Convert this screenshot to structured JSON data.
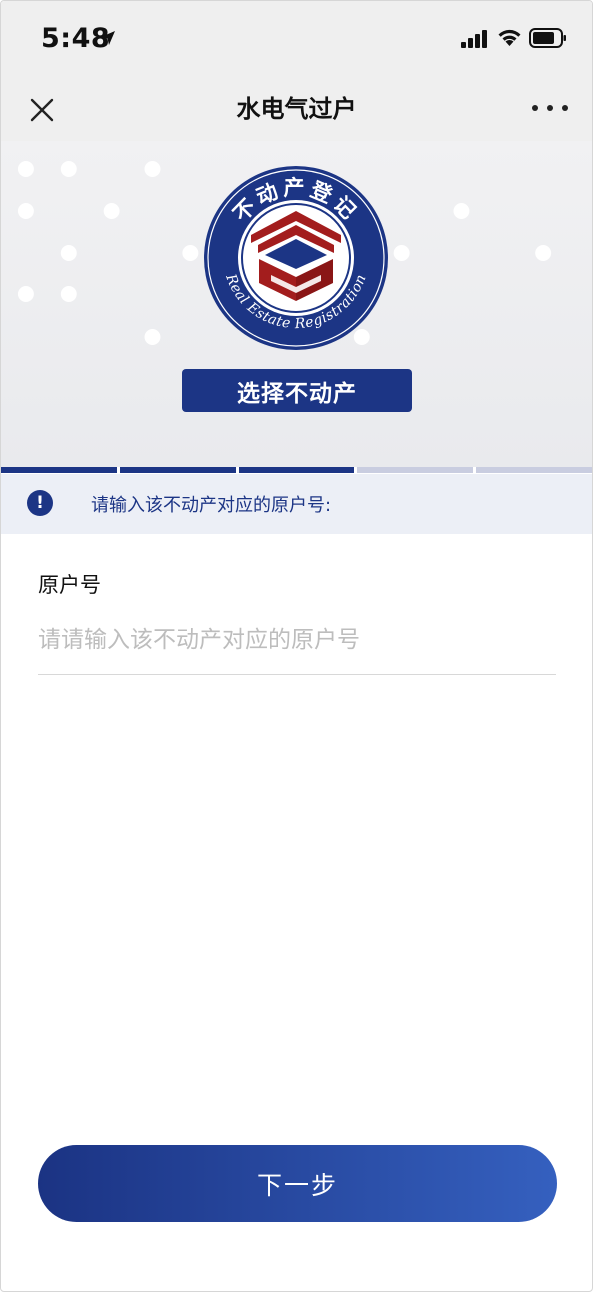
{
  "status_bar": {
    "time": "5:48",
    "icons": [
      "location-arrow-icon",
      "cellular-signal-icon",
      "wifi-icon",
      "battery-icon"
    ]
  },
  "nav": {
    "title": "水电气过户",
    "close_icon": "close-icon",
    "more_icon": "more-icon"
  },
  "hero": {
    "emblem": {
      "top_text": "不动产登记",
      "bottom_text": "Real Estate Registration",
      "ring_color": "#1c3585",
      "house_color": "#a31d1d"
    },
    "select_button_label": "选择不动产"
  },
  "progress": {
    "segments": 5,
    "completed": 3
  },
  "notice": {
    "icon": "exclamation-icon",
    "text": "请输入该不动产对应的原户号:"
  },
  "form": {
    "label": "原户号",
    "value": "",
    "placeholder": "请请输入该不动产对应的原户号"
  },
  "next_button_label": "下一步",
  "colors": {
    "primary": "#1c3585",
    "gradient_end": "#3560bf",
    "notice_bg": "#eceff6",
    "progress_inactive": "#c9cde0"
  }
}
